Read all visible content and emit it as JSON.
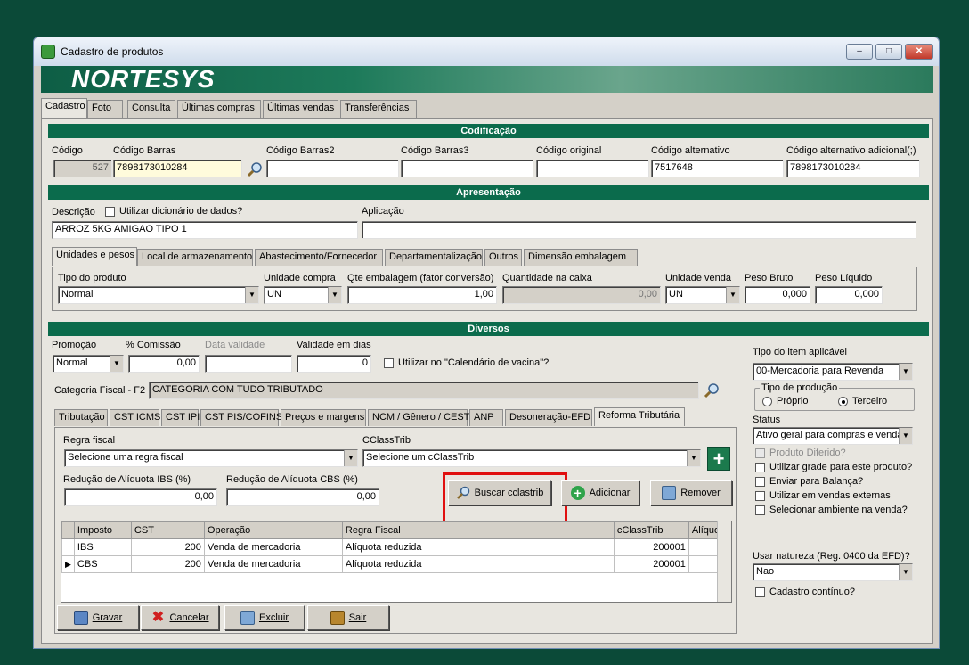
{
  "window": {
    "title": "Cadastro de produtos",
    "brand": "NORTESYS",
    "min_label": "–",
    "max_label": "□",
    "close_label": "✕"
  },
  "top_tabs": [
    "Cadastro",
    "Foto",
    "Consulta",
    "Últimas compras",
    "Últimas vendas",
    "Transferências"
  ],
  "codificacao": {
    "header": "Codificação",
    "codigo_label": "Código",
    "codigo_value": "527",
    "barras_label": "Código Barras",
    "barras_value": "7898173010284",
    "barras2_label": "Código Barras2",
    "barras2_value": "",
    "barras3_label": "Código Barras3",
    "barras3_value": "",
    "original_label": "Código original",
    "original_value": "",
    "alternativo_label": "Código alternativo",
    "alternativo_value": "7517648",
    "alt_adicional_label": "Código alternativo adicional(;)",
    "alt_adicional_value": "7898173010284"
  },
  "apresentacao": {
    "header": "Apresentação",
    "descricao_label": "Descrição",
    "dicionario_label": "Utilizar dicionário de dados?",
    "descricao_value": "ARROZ 5KG AMIGAO TIPO 1",
    "aplicacao_label": "Aplicação",
    "aplicacao_value": ""
  },
  "unit_tabs": [
    "Unidades e pesos",
    "Local de armazenamento",
    "Abastecimento/Fornecedor",
    "Departamentalização",
    "Outros",
    "Dimensão embalagem"
  ],
  "unidades": {
    "tipo_label": "Tipo do produto",
    "tipo_value": "Normal",
    "un_compra_label": "Unidade compra",
    "un_compra_value": "UN",
    "qte_emb_label": "Qte embalagem (fator conversão)",
    "qte_emb_value": "1,00",
    "qtd_caixa_label": "Quantidade na caixa",
    "qtd_caixa_value": "0,00",
    "un_venda_label": "Unidade venda",
    "un_venda_value": "UN",
    "peso_bruto_label": "Peso Bruto",
    "peso_bruto_value": "0,000",
    "peso_liquido_label": "Peso Líquido",
    "peso_liquido_value": "0,000"
  },
  "diversos": {
    "header": "Diversos",
    "promocao_label": "Promoção",
    "promocao_value": "Normal",
    "comissao_label": "% Comissão",
    "comissao_value": "0,00",
    "data_validade_label": "Data validade",
    "data_validade_value": "",
    "validade_dias_label": "Validade em dias",
    "validade_dias_value": "0",
    "vacina_label": "Utilizar no \"Calendário de vacina\"?",
    "cat_fiscal_label": "Categoria Fiscal - F2",
    "cat_fiscal_value": "CATEGORIA COM TUDO TRIBUTADO"
  },
  "tax_tabs": [
    "Tributação",
    "CST ICMS",
    "CST IPI",
    "CST PIS/COFINS",
    "Preços e margens",
    "NCM / Gênero / CEST",
    "ANP",
    "Desoneração-EFD",
    "Reforma Tributária"
  ],
  "reforma": {
    "regra_label": "Regra fiscal",
    "regra_value": "Selecione uma regra fiscal",
    "cclass_label": "CClassTrib",
    "cclass_value": "Selecione um cClassTrib",
    "plus_label": "+",
    "red_ibs_label": "Redução de Alíquota IBS (%)",
    "red_ibs_value": "0,00",
    "red_cbs_label": "Redução de Alíquota CBS (%)",
    "red_cbs_value": "0,00",
    "buscar_label": "Buscar cclastrib",
    "adicionar_label": "Adicionar",
    "remover_label": "Remover",
    "grid": {
      "columns": [
        "Imposto",
        "CST",
        "Operação",
        "Regra Fiscal",
        "cClassTrib",
        "Alíquot"
      ],
      "rows": [
        [
          "IBS",
          "200",
          "Venda de mercadoria",
          "Alíquota reduzida",
          "200001",
          ""
        ],
        [
          "CBS",
          "200",
          "Venda de mercadoria",
          "Alíquota reduzida",
          "200001",
          ""
        ]
      ],
      "current_row_marker": "▶"
    }
  },
  "right_panel": {
    "tipo_item_label": "Tipo do item aplicável",
    "tipo_item_value": "00-Mercadoria para Revenda",
    "tipo_producao_label": "Tipo de produção",
    "proprio_label": "Próprio",
    "terceiro_label": "Terceiro",
    "status_label": "Status",
    "status_value": "Ativo geral para compras e venda",
    "produto_diferido_label": "Produto Diferido?",
    "grade_label": "Utilizar grade para este produto?",
    "balanca_label": "Enviar para Balança?",
    "vendas_externas_label": "Utilizar em vendas externas",
    "ambiente_label": "Selecionar ambiente na venda?",
    "natureza_label": "Usar natureza (Reg. 0400 da EFD)?",
    "natureza_value": "Nao",
    "cadastro_continuo_label": "Cadastro contínuo?"
  },
  "footer": {
    "gravar": "Gravar",
    "cancelar": "Cancelar",
    "excluir": "Excluir",
    "sair": "Sair"
  },
  "colors": {
    "brand_green": "#0b6b4c",
    "highlight_red": "#e01010",
    "background": "#0b4a38"
  }
}
